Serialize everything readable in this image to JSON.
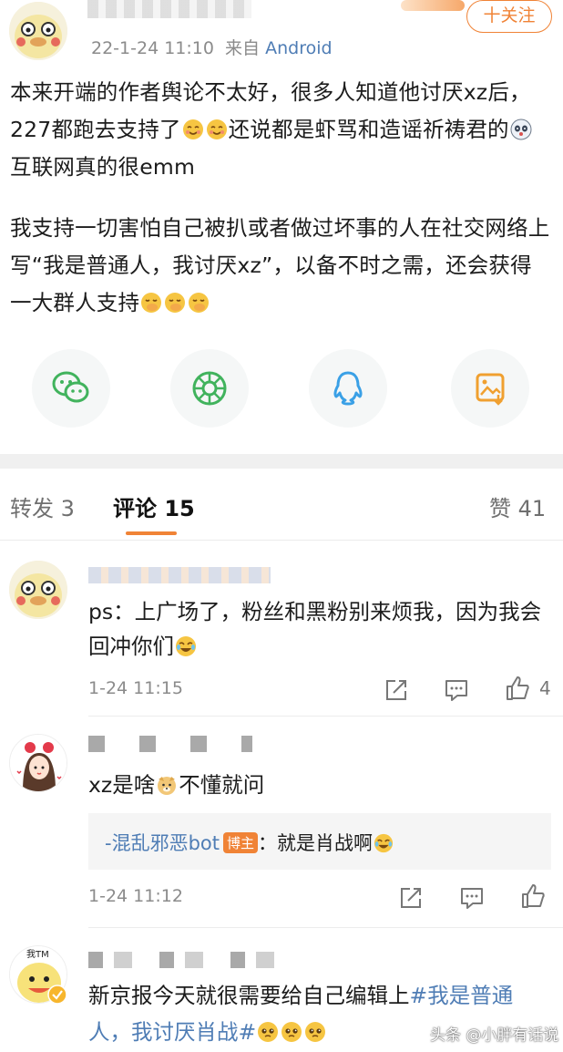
{
  "post": {
    "time": "22-1-24 11:10",
    "source_prefix": "来自",
    "source": "Android",
    "follow_label": "十关注",
    "paragraph1": [
      "本来开端的作者舆论不太好，很多人知道他讨厌xz后，227都跑去支持了",
      "还说都是虾骂和造谣祈祷君的",
      "互联网真的很emm"
    ],
    "paragraph2": [
      "我支持一切害怕自己被扒或者做过坏事的人在社交网络上写“我是普通人，我讨厌xz”，以备不时之需，还会获得一大群人支持"
    ]
  },
  "share_icons": [
    "wechat-icon",
    "moments-icon",
    "qq-icon",
    "save-image-icon"
  ],
  "tabs": {
    "repost": "转发 3",
    "comments": "评论 15",
    "likes": "赞 41"
  },
  "comments": [
    {
      "text_parts": [
        "ps：上广场了，粉丝和黑粉别来烦我，因为我会回冲你们"
      ],
      "time": "1-24 11:15",
      "like_count": "4"
    },
    {
      "text_parts": [
        "xz是啥",
        "不懂就问"
      ],
      "reply": {
        "author": "-混乱邪恶bot",
        "badge": "博主",
        "text": "：就是肖战啊"
      },
      "time": "1-24 11:12"
    },
    {
      "avatar_text": "我TM",
      "text_prefix": "新京报今天就很需要给自己编辑上",
      "hashtag": "#我是普通人，我讨厌肖战#"
    }
  ],
  "watermark": "头条 @小胖有话说",
  "colors": {
    "accent": "#f08336",
    "link": "#4f7db5",
    "meta": "#8b8b8b"
  }
}
